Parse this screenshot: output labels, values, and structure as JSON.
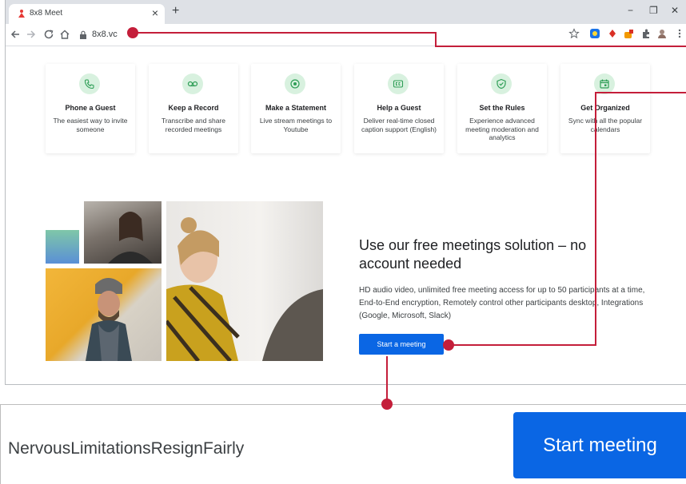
{
  "browser": {
    "tab_title": "8x8 Meet",
    "tab_close": "×",
    "new_tab": "+",
    "url": "8x8.vc",
    "window_controls": {
      "minimize": "−",
      "restore": "❐",
      "close": "✕"
    }
  },
  "features": [
    {
      "icon": "phone-icon",
      "title": "Phone a Guest",
      "description": "The easiest way to invite someone"
    },
    {
      "icon": "voicemail-icon",
      "title": "Keep a Record",
      "description": "Transcribe and share recorded meetings"
    },
    {
      "icon": "broadcast-icon",
      "title": "Make a Statement",
      "description": "Live stream meetings to Youtube"
    },
    {
      "icon": "closed-caption-icon",
      "title": "Help a Guest",
      "description": "Deliver real-time closed caption support (English)"
    },
    {
      "icon": "shield-icon",
      "title": "Set the Rules",
      "description": "Experience advanced meeting moderation and analytics"
    },
    {
      "icon": "calendar-icon",
      "title": "Get Organized",
      "description": "Sync with all the popular calendars"
    }
  ],
  "hero": {
    "headline": "Use our free meetings solution – no account needed",
    "body": "HD audio video, unlimited free meeting access for up to 50 participants at a time, End-to-End encryption, Remotely control other participants desktop, Integrations (Google, Microsoft, Slack)",
    "button_label": "Start a meeting"
  },
  "zoom_panel": {
    "meeting_name": "NervousLimitationsResignFairly",
    "button_label": "Start meeting"
  },
  "colors": {
    "accent": "#0a66e4",
    "callout": "#c41e3a",
    "icon_bg": "#d8f1df",
    "icon_fg": "#2e9e56"
  }
}
